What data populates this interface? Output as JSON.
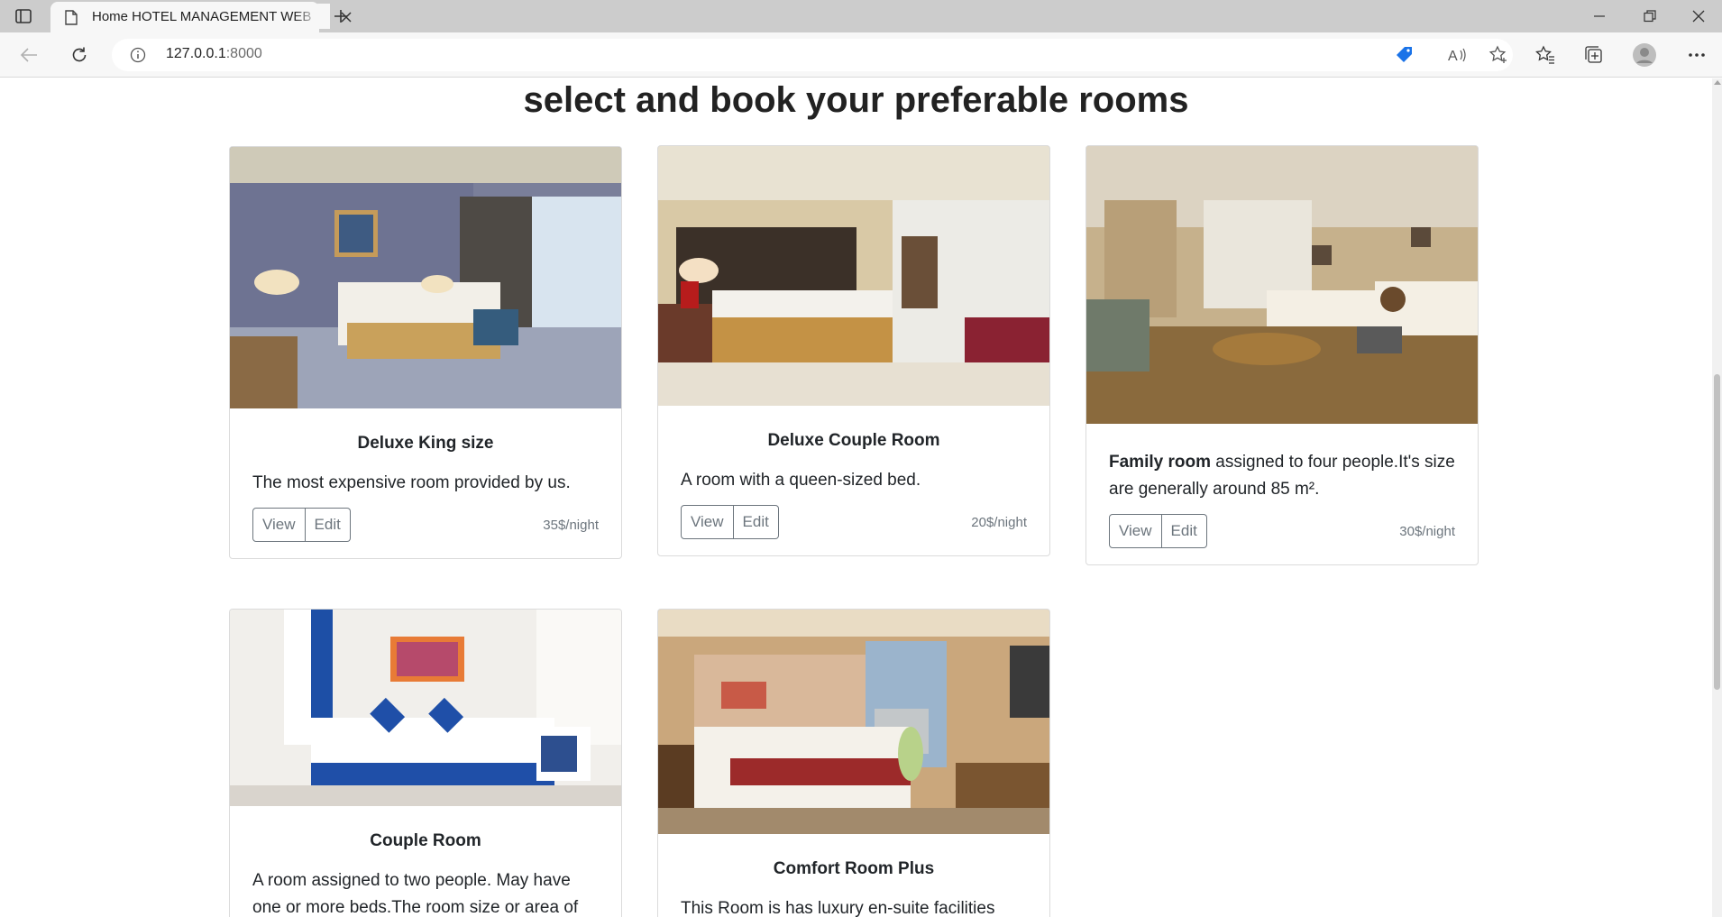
{
  "browser": {
    "tab_title": "Home HOTEL MANAGEMENT WEB",
    "url_host": "127.0.0.1",
    "url_port": ":8000"
  },
  "page": {
    "heading": "select and book your preferable rooms"
  },
  "rooms": [
    {
      "title": "Deluxe King size",
      "description": "The most expensive room provided by us.",
      "view_label": "View",
      "edit_label": "Edit",
      "price": "35$/night",
      "image": "deluxe-king-room-photo"
    },
    {
      "title": "Deluxe Couple Room",
      "description": "A room with a queen-sized bed.",
      "view_label": "View",
      "edit_label": "Edit",
      "price": "20$/night",
      "image": "deluxe-couple-room-photo"
    },
    {
      "title_bold": "Family room",
      "description": " assigned to four people.It's size are generally around 85 m².",
      "view_label": "View",
      "edit_label": "Edit",
      "price": "30$/night",
      "image": "family-room-photo"
    },
    {
      "title": "Couple Room",
      "description": "A room assigned to two people. May have one or more beds.The room size or area of",
      "image": "couple-room-photo"
    },
    {
      "title": "Comfort Room Plus",
      "description": "This Room is has luxury en-suite facilities",
      "image": "comfort-room-plus-photo"
    }
  ],
  "colors": {
    "tabbar": "#cccccc",
    "toolbar": "#f7f7f7",
    "button_border": "#6c757d",
    "text": "#212529"
  }
}
